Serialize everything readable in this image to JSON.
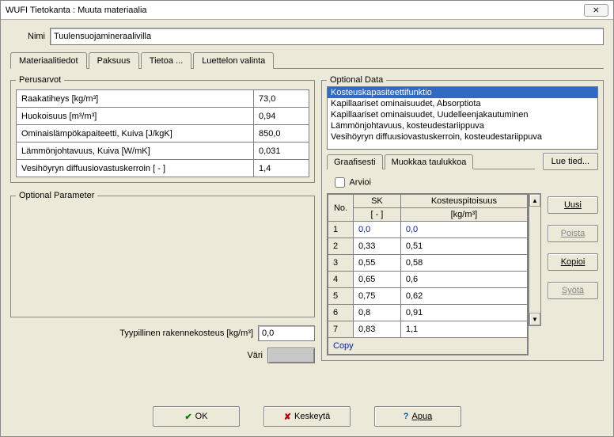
{
  "title": "WUFI Tietokanta : Muuta materiaalia",
  "close_glyph": "⨯",
  "nimi": {
    "label": "Nimi",
    "value": "Tuulensuojamineraalivilla"
  },
  "tabs": {
    "t0": "Materiaalitiedot",
    "t1": "Paksuus",
    "t2": "Tietoa ...",
    "t3": "Luettelon valinta"
  },
  "basic": {
    "legend": "Perusarvot",
    "rows": [
      {
        "label": "Raakatiheys [kg/m³]",
        "value": "73,0"
      },
      {
        "label": "Huokoisuus [m³/m³]",
        "value": "0,94"
      },
      {
        "label": "Ominaislämpökapaiteetti, Kuiva [J/kgK]",
        "value": "850,0"
      },
      {
        "label": "Lämmönjohtavuus, Kuiva [W/mK]",
        "value": "0,031"
      },
      {
        "label": "Vesihöyryn diffuusiovastuskerroin [ - ]",
        "value": "1,4"
      }
    ]
  },
  "optparam_legend": "Optional Parameter",
  "typ_moisture": {
    "label": "Tyypillinen rakennekosteus [kg/m³]",
    "value": "0,0"
  },
  "color_label": "Väri",
  "optdata": {
    "legend": "Optional Data",
    "items": [
      "Kosteuskapasiteettifunktio",
      "Kapillaariset ominaisuudet, Absorptiota",
      "Kapillaariset ominaisuudet, Uudelleenjakautuminen",
      "Lämmönjohtavuus, kosteudestariippuva",
      "Vesihöyryn diffuusiovastuskerroin, kosteudestariippuva"
    ],
    "subtabs": {
      "s0": "Graafisesti",
      "s1": "Muokkaa taulukkoa"
    },
    "read_btn": "Lue tied...",
    "arvioi": "Arvioi",
    "headers": {
      "no": "No.",
      "sk": "SK",
      "sk_unit": "[ - ]",
      "kp": "Kosteuspitoisuus",
      "kp_unit": "[kg/m³]"
    },
    "rows": [
      {
        "n": "1",
        "a": "0,0",
        "b": "0,0"
      },
      {
        "n": "2",
        "a": "0,33",
        "b": "0,51"
      },
      {
        "n": "3",
        "a": "0,55",
        "b": "0,58"
      },
      {
        "n": "4",
        "a": "0,65",
        "b": "0,6"
      },
      {
        "n": "5",
        "a": "0,75",
        "b": "0,62"
      },
      {
        "n": "6",
        "a": "0,8",
        "b": "0,91"
      },
      {
        "n": "7",
        "a": "0,83",
        "b": "1,1"
      }
    ],
    "copy": "Copy"
  },
  "side_buttons": {
    "uusi": "Uusi",
    "poista": "Poista",
    "kopioi": "Kopioi",
    "syota": "Syötä"
  },
  "bottom": {
    "ok": "OK",
    "cancel": "Keskeytä",
    "help": "Apua"
  }
}
